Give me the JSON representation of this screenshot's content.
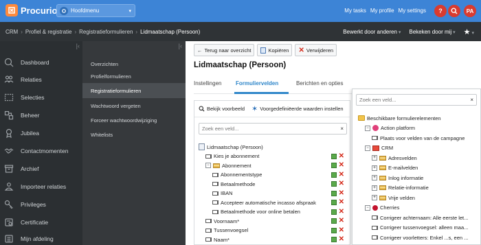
{
  "app": {
    "name": "Procurios"
  },
  "topbar": {
    "menu_select": "Hoofdmenu",
    "links": [
      "My tasks",
      "My profile",
      "My settings"
    ],
    "help": "?",
    "avatar": "PA"
  },
  "breadcrumb": {
    "items": [
      "CRM",
      "Profiel & registratie",
      "Registratieformulieren"
    ],
    "current": "Lidmaatschap (Persoon)",
    "right": [
      "Bewerkt door anderen",
      "Bekeken door mij"
    ]
  },
  "nav": {
    "items": [
      "Dashboard",
      "Relaties",
      "Selecties",
      "Beheer",
      "Jubilea",
      "Contactmomenten",
      "Archief",
      "Importeer relaties",
      "Privileges",
      "Certificatie",
      "Mijn afdeling"
    ]
  },
  "subnav": {
    "items": [
      "Overzichten",
      "Profielformulieren",
      "Registratieformulieren",
      "Wachtwoord vergeten",
      "Forceer wachtwoordwijziging",
      "Whitelists"
    ],
    "active_index": 2
  },
  "main": {
    "back_label": "Terug naar overzicht",
    "copy_label": "Kopiëren",
    "delete_label": "Verwijderen",
    "title": "Lidmaatschap (Persoon)",
    "tabs": [
      "Instellingen",
      "Formuliervelden",
      "Berichten en opties"
    ],
    "active_tab": 1
  },
  "left_panel": {
    "preview_label": "Bekijk voorbeeld",
    "predefined_label": "Voorgedefiniëerde waarden instellen",
    "search_placeholder": "Zoek een veld...",
    "tree": [
      {
        "label": "Lidmaatschap (Persoon)",
        "type": "root",
        "level": 0
      },
      {
        "label": "Kies je abonnement",
        "type": "field",
        "level": 1
      },
      {
        "label": "Abonnement",
        "type": "group",
        "level": 1
      },
      {
        "label": "Abonnementstype",
        "type": "field",
        "level": 2
      },
      {
        "label": "Betaalmethode",
        "type": "field",
        "level": 2
      },
      {
        "label": "IBAN",
        "type": "field",
        "level": 2
      },
      {
        "label": "Accepteer automatische incasso afspraak",
        "type": "field",
        "level": 2
      },
      {
        "label": "Betaalmethode voor online betalen",
        "type": "field",
        "level": 2
      },
      {
        "label": "Voornaam*",
        "type": "field",
        "level": 1
      },
      {
        "label": "Tussenvoegsel",
        "type": "field",
        "level": 1
      },
      {
        "label": "Naam*",
        "type": "field",
        "level": 1
      }
    ]
  },
  "right_panel": {
    "search_placeholder": "Zoek een veld...",
    "tree": [
      {
        "label": "Beschikbare formulierelementen",
        "type": "folder",
        "level": 0
      },
      {
        "label": "Action platform",
        "type": "plugin",
        "level": 1
      },
      {
        "label": "Plaats voor velden van de campagne",
        "type": "field",
        "level": 2
      },
      {
        "label": "CRM",
        "type": "crm",
        "level": 1
      },
      {
        "label": "Adresvelden",
        "type": "group",
        "level": 2
      },
      {
        "label": "E-mailvelden",
        "type": "group",
        "level": 2
      },
      {
        "label": "Inlog informatie",
        "type": "group",
        "level": 2
      },
      {
        "label": "Relatie-informatie",
        "type": "group",
        "level": 2
      },
      {
        "label": "Vrije velden",
        "type": "group",
        "level": 2
      },
      {
        "label": "Cherries",
        "type": "cherry",
        "level": 1
      },
      {
        "label": "Corrigeer achternaam: Alle eerste let...",
        "type": "field",
        "level": 2
      },
      {
        "label": "Corrigeer tussenvoegsel: alleen maa...",
        "type": "field",
        "level": 2
      },
      {
        "label": "Corrigeer voorletters: Enkel ...s, een ...",
        "type": "field",
        "level": 2
      }
    ]
  },
  "colors": {
    "topbar": "#3d84d6",
    "accent": "#2e86c9",
    "nav_bg": "#2b2f32",
    "danger": "#d93b2f"
  }
}
